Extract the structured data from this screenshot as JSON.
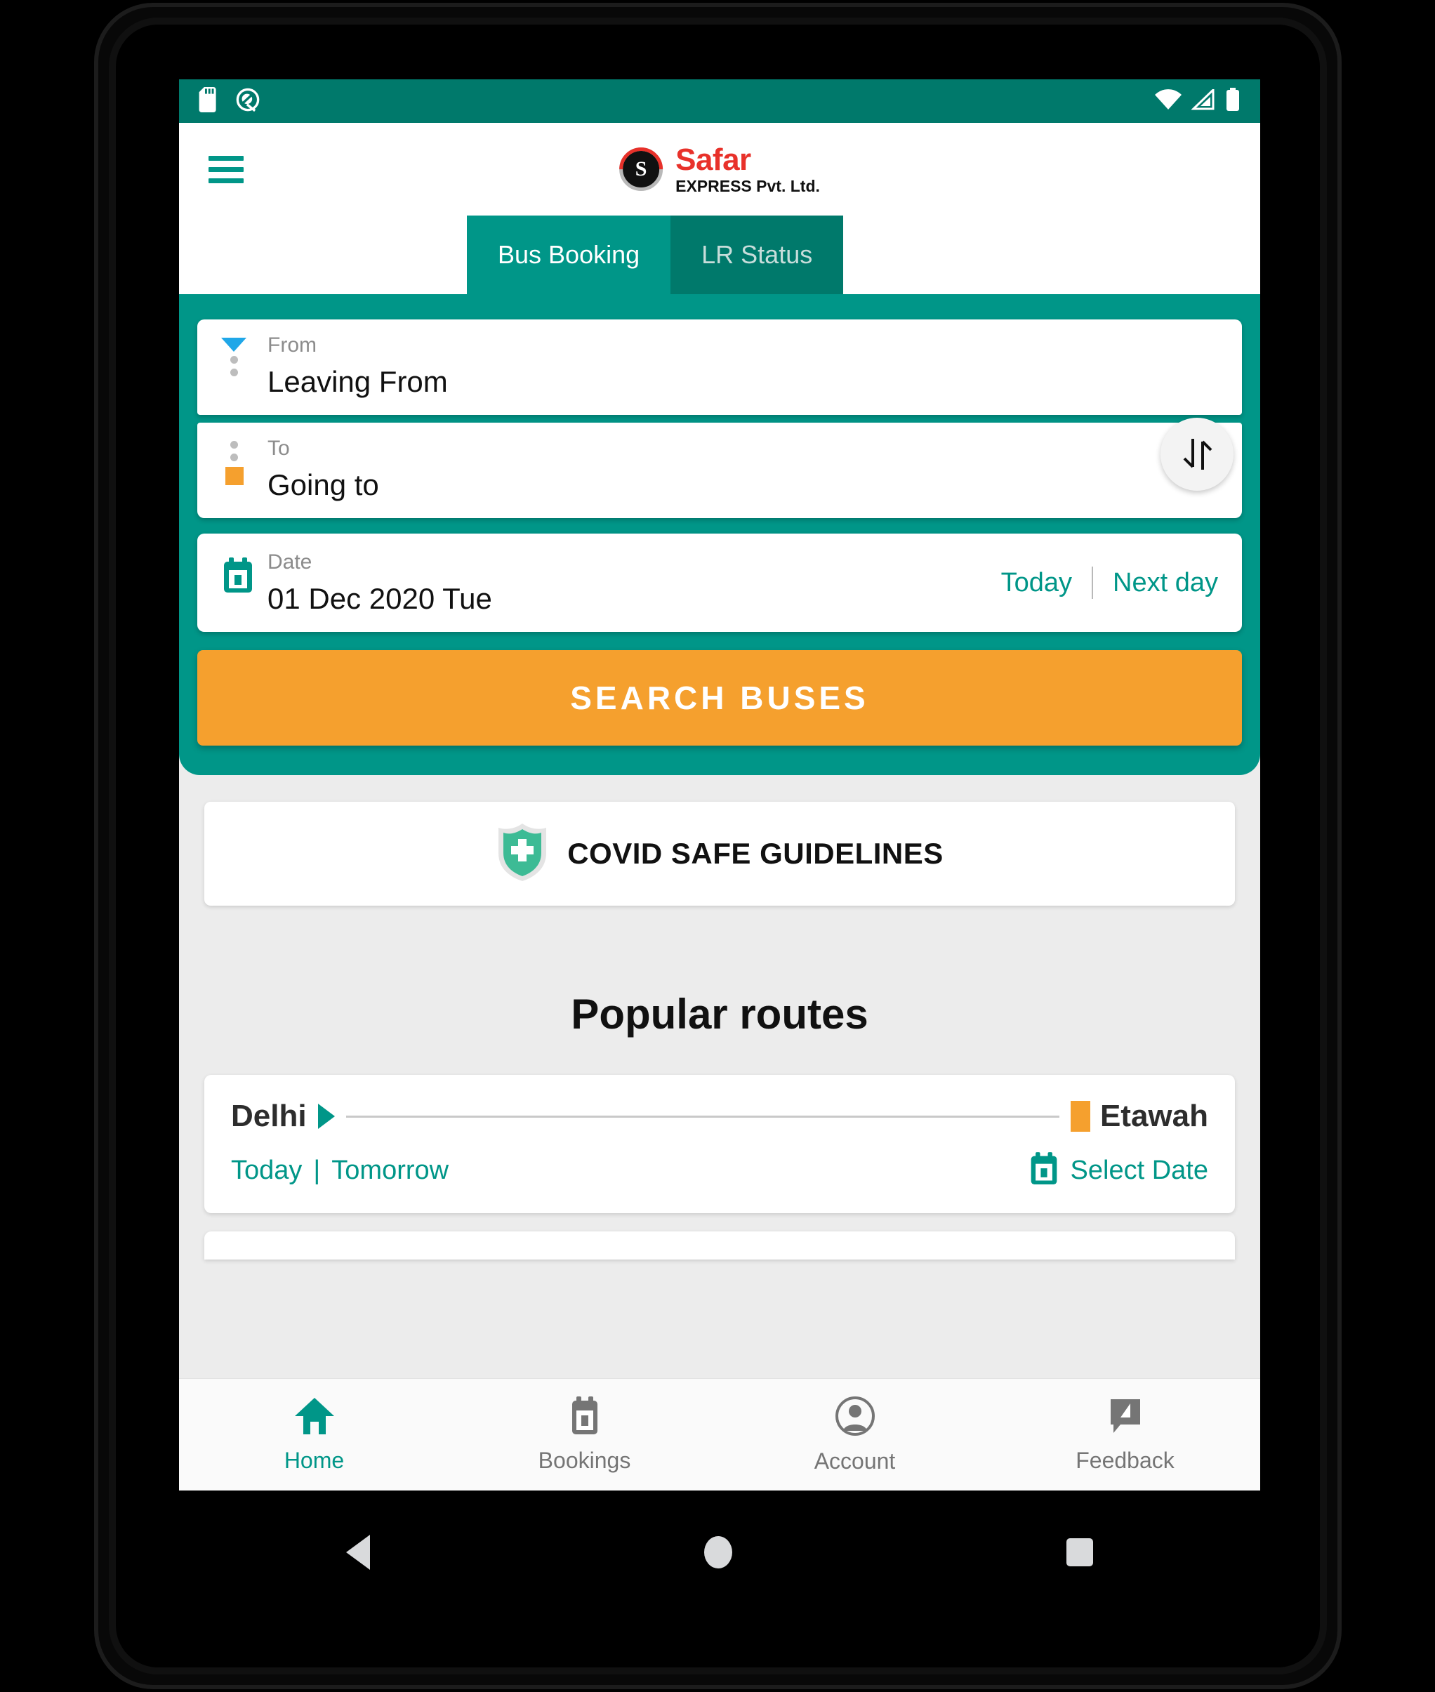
{
  "status_bar": {
    "icons_left": [
      "sd-card-icon",
      "android-q-icon"
    ],
    "icons_right": [
      "wifi-icon",
      "signal-icon",
      "battery-icon"
    ],
    "background": "#00796B"
  },
  "app_bar": {
    "menu_icon": "hamburger-menu-icon",
    "brand_name": "Safar",
    "brand_sub": "EXPRESS Pvt. Ltd.",
    "brand_mark_glyph": "S",
    "brand_color": "#e8312a"
  },
  "tabs": [
    {
      "label": "Bus Booking",
      "active": true
    },
    {
      "label": "LR Status",
      "active": false
    }
  ],
  "search_panel": {
    "accent": "#009688",
    "from": {
      "label": "From",
      "value": "Leaving From",
      "icon": "triangle-down-icon"
    },
    "to": {
      "label": "To",
      "value": "Going to",
      "icon": "orange-square-icon"
    },
    "swap_icon": "swap-vertical-icon",
    "date": {
      "label": "Date",
      "value": "01 Dec 2020 Tue",
      "icon": "calendar-icon",
      "today_label": "Today",
      "next_day_label": "Next day"
    },
    "search_button": "SEARCH BUSES",
    "search_button_color": "#F5A02E"
  },
  "covid": {
    "icon": "shield-plus-icon",
    "label": "COVID SAFE GUIDELINES",
    "icon_color": "#3dbb95"
  },
  "popular": {
    "title": "Popular routes",
    "routes": [
      {
        "from": "Delhi",
        "to": "Etawah",
        "today_label": "Today",
        "separator": "|",
        "tomorrow_label": "Tomorrow",
        "select_date_label": "Select Date",
        "calendar_icon": "calendar-icon"
      }
    ]
  },
  "bottom_nav": [
    {
      "label": "Home",
      "icon": "home-icon",
      "active": true
    },
    {
      "label": "Bookings",
      "icon": "bookings-calendar-icon",
      "active": false
    },
    {
      "label": "Account",
      "icon": "account-person-icon",
      "active": false
    },
    {
      "label": "Feedback",
      "icon": "feedback-pencil-icon",
      "active": false
    }
  ],
  "system_nav": {
    "back": "back-triangle-icon",
    "home": "home-circle-icon",
    "recents": "recents-square-icon"
  }
}
